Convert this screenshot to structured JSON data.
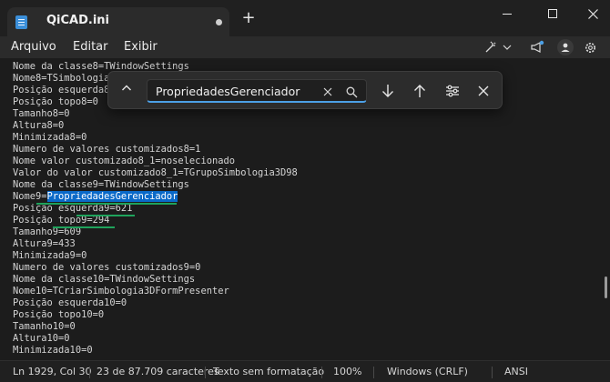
{
  "window": {
    "tab_title": "QiCAD.ini",
    "new_tab": "+"
  },
  "menu": {
    "items": [
      "Arquivo",
      "Editar",
      "Exibir"
    ]
  },
  "find": {
    "query": "PropriedadesGerenciador"
  },
  "editor": {
    "lines": [
      "Nome da classe8=TWindowSettings",
      "Nome8=TSimbologiaConfig",
      "Posição esquerda8=0",
      "Posição topo8=0",
      "Tamanho8=0",
      "Altura8=0",
      "Minimizada8=0",
      "Numero de valores customizados8=1",
      "Nome valor customizado8_1=noselecionado",
      "Valor do valor customizado8_1=TGrupoSimbologia3D98",
      "Nome da classe9=TWindowSettings",
      "Nome9=PropriedadesGerenciador",
      "Posição esquerda9=621",
      "Posição topo9=294",
      "Tamanho9=609",
      "Altura9=433",
      "Minimizada9=0",
      "Numero de valores customizados9=0",
      "Nome da classe10=TWindowSettings",
      "Nome10=TCriarSimbologia3DFormPresenter",
      "Posição esquerda10=0",
      "Posição topo10=0",
      "Tamanho10=0",
      "Altura10=0",
      "Minimizada10=0"
    ],
    "highlight_line_prefix": "Nome9=",
    "highlight_match": "PropriedadesGerenciador",
    "colors": {
      "selection": "#0a69c8",
      "underline": "#1fa35c"
    }
  },
  "status": {
    "position": "Ln 1929, Col 30",
    "chars": "23 de 87.709 caracteres",
    "format": "Texto sem formatação",
    "zoom": "100%",
    "line_ending": "Windows (CRLF)",
    "encoding": "ANSI"
  },
  "icons": [
    "notepad-icon",
    "modified-dot-icon",
    "minimize-icon",
    "maximize-icon",
    "close-icon",
    "copilot-icon",
    "chevron-down-icon",
    "megaphone-icon",
    "account-icon",
    "gear-icon",
    "chevron-up-icon",
    "clear-icon",
    "search-icon",
    "arrow-down-icon",
    "arrow-up-icon",
    "find-options-icon"
  ]
}
